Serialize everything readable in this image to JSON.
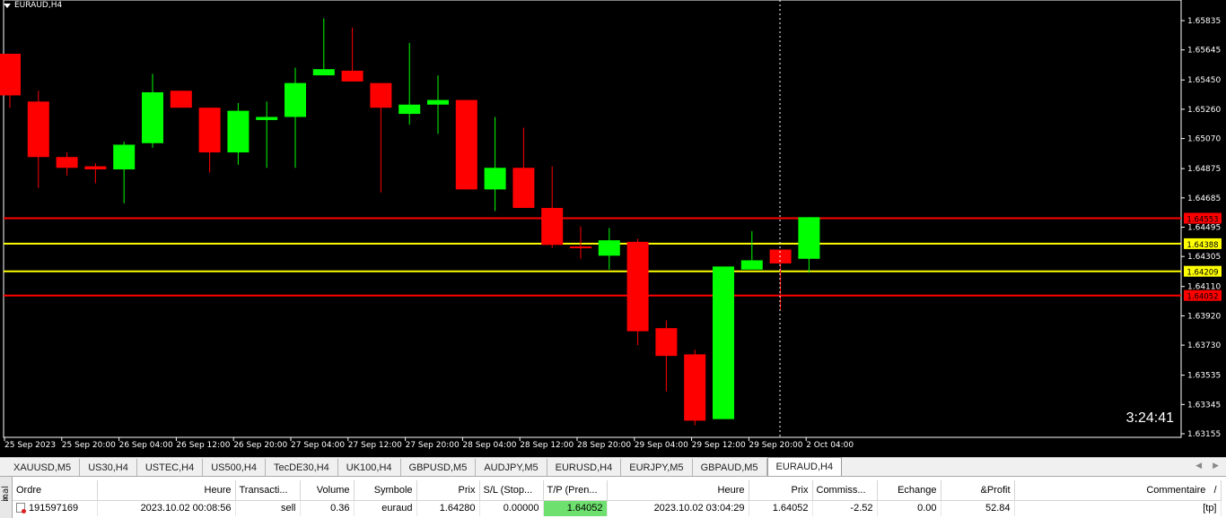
{
  "chart": {
    "title": "EURAUD,H4",
    "countdown": "3:24:41",
    "colors": {
      "bull": "#00ff00",
      "bear": "#ff0000",
      "background": "#000000",
      "grid_text": "#ffffff",
      "line_red": "#ff0000",
      "line_yellow": "#ffff00"
    }
  },
  "chart_data": {
    "type": "candlestick",
    "symbol": "EURAUD",
    "timeframe": "H4",
    "ylim": [
      1.63155,
      1.65835
    ],
    "y_ticks": [
      "1.65835",
      "1.65645",
      "1.65450",
      "1.65260",
      "1.65070",
      "1.64875",
      "1.64685",
      "1.64495",
      "1.64305",
      "1.64110",
      "1.63920",
      "1.63730",
      "1.63535",
      "1.63345",
      "1.63155"
    ],
    "x_ticks": [
      "25 Sep 2023",
      "25 Sep 20:00",
      "26 Sep 04:00",
      "26 Sep 12:00",
      "26 Sep 20:00",
      "27 Sep 04:00",
      "27 Sep 12:00",
      "27 Sep 20:00",
      "28 Sep 04:00",
      "28 Sep 12:00",
      "28 Sep 20:00",
      "29 Sep 04:00",
      "29 Sep 12:00",
      "29 Sep 20:00",
      "2 Oct 04:00"
    ],
    "candles": [
      {
        "o": 1.6562,
        "h": 1.6562,
        "c": 1.6535,
        "l": 1.6527
      },
      {
        "o": 1.6531,
        "h": 1.6538,
        "c": 1.6495,
        "l": 1.6475
      },
      {
        "o": 1.6495,
        "h": 1.6498,
        "c": 1.6488,
        "l": 1.6483
      },
      {
        "o": 1.6489,
        "h": 1.6491,
        "c": 1.6487,
        "l": 1.6478
      },
      {
        "o": 1.6487,
        "h": 1.6505,
        "c": 1.6503,
        "l": 1.6465
      },
      {
        "o": 1.6504,
        "h": 1.6549,
        "c": 1.6537,
        "l": 1.6501
      },
      {
        "o": 1.6538,
        "h": 1.6538,
        "c": 1.6527,
        "l": 1.6527
      },
      {
        "o": 1.6527,
        "h": 1.6527,
        "c": 1.6498,
        "l": 1.6485
      },
      {
        "o": 1.6498,
        "h": 1.653,
        "c": 1.6525,
        "l": 1.649
      },
      {
        "o": 1.6519,
        "h": 1.6531,
        "c": 1.6521,
        "l": 1.6488
      },
      {
        "o": 1.6521,
        "h": 1.6553,
        "c": 1.6543,
        "l": 1.6488
      },
      {
        "o": 1.6548,
        "h": 1.6585,
        "c": 1.6552,
        "l": 1.6548
      },
      {
        "o": 1.6551,
        "h": 1.6579,
        "c": 1.6544,
        "l": 1.6544
      },
      {
        "o": 1.6543,
        "h": 1.6543,
        "c": 1.6527,
        "l": 1.6472
      },
      {
        "o": 1.6523,
        "h": 1.6569,
        "c": 1.6529,
        "l": 1.6516
      },
      {
        "o": 1.6529,
        "h": 1.6548,
        "c": 1.6532,
        "l": 1.651
      },
      {
        "o": 1.6532,
        "h": 1.6532,
        "c": 1.6474,
        "l": 1.6474
      },
      {
        "o": 1.6474,
        "h": 1.6521,
        "c": 1.6488,
        "l": 1.646
      },
      {
        "o": 1.6488,
        "h": 1.6514,
        "c": 1.6462,
        "l": 1.6462
      },
      {
        "o": 1.6462,
        "h": 1.6489,
        "c": 1.6438,
        "l": 1.6436
      },
      {
        "o": 1.6437,
        "h": 1.645,
        "c": 1.6436,
        "l": 1.6429
      },
      {
        "o": 1.6431,
        "h": 1.6449,
        "c": 1.6441,
        "l": 1.6422
      },
      {
        "o": 1.644,
        "h": 1.6442,
        "c": 1.6382,
        "l": 1.6373
      },
      {
        "o": 1.6384,
        "h": 1.6389,
        "c": 1.6366,
        "l": 1.6343
      },
      {
        "o": 1.6367,
        "h": 1.637,
        "c": 1.6324,
        "l": 1.6321
      },
      {
        "o": 1.6325,
        "h": 1.6424,
        "c": 1.6424,
        "l": 1.6325
      },
      {
        "o": 1.6422,
        "h": 1.6447,
        "c": 1.6428,
        "l": 1.6422
      },
      {
        "o": 1.6435,
        "h": 1.6435,
        "c": 1.6426,
        "l": 1.6396
      },
      {
        "o": 1.6429,
        "h": 1.6456,
        "c": 1.6456,
        "l": 1.642
      }
    ],
    "levels": [
      {
        "price": 1.64553,
        "label": "1.64553",
        "color": "#ff0000"
      },
      {
        "price": 1.64388,
        "label": "1.64388",
        "color": "#ffff00"
      },
      {
        "price": 1.64209,
        "label": "1.64209",
        "color": "#ffff00"
      },
      {
        "price": 1.64052,
        "label": "1.64052",
        "color": "#ff0000"
      }
    ]
  },
  "tabs": [
    "XAUUSD,M5",
    "US30,H4",
    "USTEC,H4",
    "US500,H4",
    "TecDE30,H4",
    "UK100,H4",
    "GBPUSD,M5",
    "AUDJPY,M5",
    "EURUSD,H4",
    "EURJPY,M5",
    "GBPAUD,M5",
    "EURAUD,H4"
  ],
  "active_tab": "EURAUD,H4",
  "terminal": {
    "side_label": "inal",
    "close_label": "×",
    "columns": [
      "Ordre",
      "Heure",
      "Transacti...",
      "Volume",
      "Symbole",
      "Prix",
      "S/L (Stop...",
      "T/P (Pren...",
      "Heure",
      "Prix",
      "Commiss...",
      "Echange",
      "&Profit",
      "Commentaire"
    ],
    "rows": [
      [
        "191597169",
        "2023.10.02 00:08:56",
        "sell",
        "0.36",
        "euraud",
        "1.64280",
        "0.00000",
        "1.64052",
        "2023.10.02 03:04:29",
        "1.64052",
        "-2.52",
        "0.00",
        "52.84",
        "[tp]"
      ]
    ],
    "sort_icon": "/"
  }
}
